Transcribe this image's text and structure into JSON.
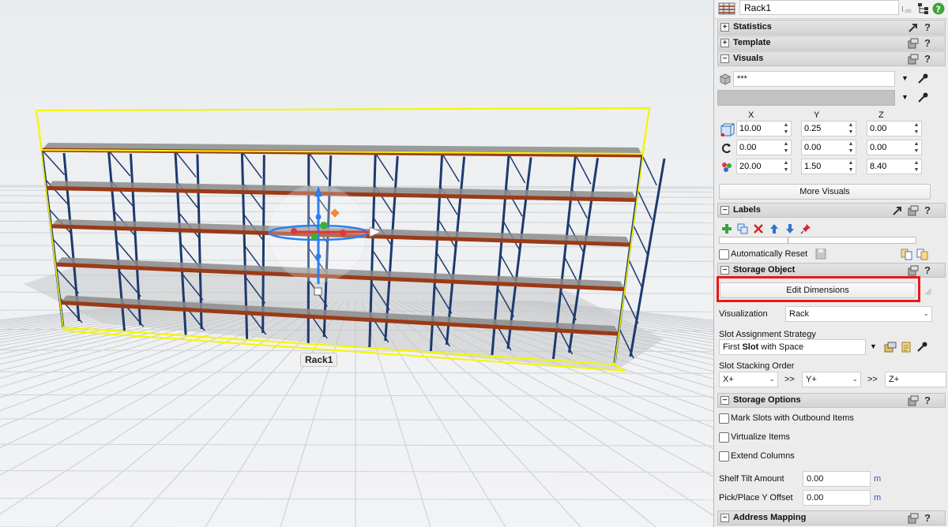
{
  "viewport": {
    "object_label": "Rack1"
  },
  "panel": {
    "object_name": "Rack1",
    "sections": {
      "statistics": "Statistics",
      "template": "Template",
      "visuals": "Visuals",
      "labels": "Labels",
      "storage_object": "Storage Object",
      "storage_options": "Storage Options",
      "address_mapping": "Address Mapping"
    },
    "visuals": {
      "shape_value": "***",
      "col_x": "X",
      "col_y": "Y",
      "col_z": "Z",
      "position": {
        "x": "10.00",
        "y": "0.25",
        "z": "0.00"
      },
      "rotation": {
        "x": "0.00",
        "y": "0.00",
        "z": "0.00"
      },
      "size": {
        "x": "20.00",
        "y": "1.50",
        "z": "8.40"
      },
      "more_visuals": "More Visuals"
    },
    "labels": {
      "automatically_reset": "Automatically Reset"
    },
    "storage_object": {
      "edit_dimensions": "Edit Dimensions",
      "visualization_label": "Visualization",
      "visualization_value": "Rack",
      "slot_assignment_label": "Slot Assignment Strategy",
      "slot_assignment_prefix": "First ",
      "slot_assignment_bold": "Slot",
      "slot_assignment_suffix": " with Space",
      "slot_stacking_label": "Slot Stacking Order",
      "stack_1": "X+",
      "stack_2": "Y+",
      "stack_3": "Z+",
      "sep": ">>"
    },
    "storage_options": {
      "mark_slots": "Mark Slots with Outbound Items",
      "virtualize": "Virtualize Items",
      "extend_columns": "Extend Columns",
      "shelf_tilt_label": "Shelf Tilt Amount",
      "shelf_tilt_value": "0.00",
      "pick_place_label": "Pick/Place Y Offset",
      "pick_place_value": "0.00",
      "unit": "m"
    },
    "help": "?"
  },
  "colors": {
    "highlight": "#e81818",
    "selection": "#f5f500",
    "shelf": "#9b3a16",
    "upright": "#1d3a6e",
    "deck": "#8c8c8c"
  }
}
